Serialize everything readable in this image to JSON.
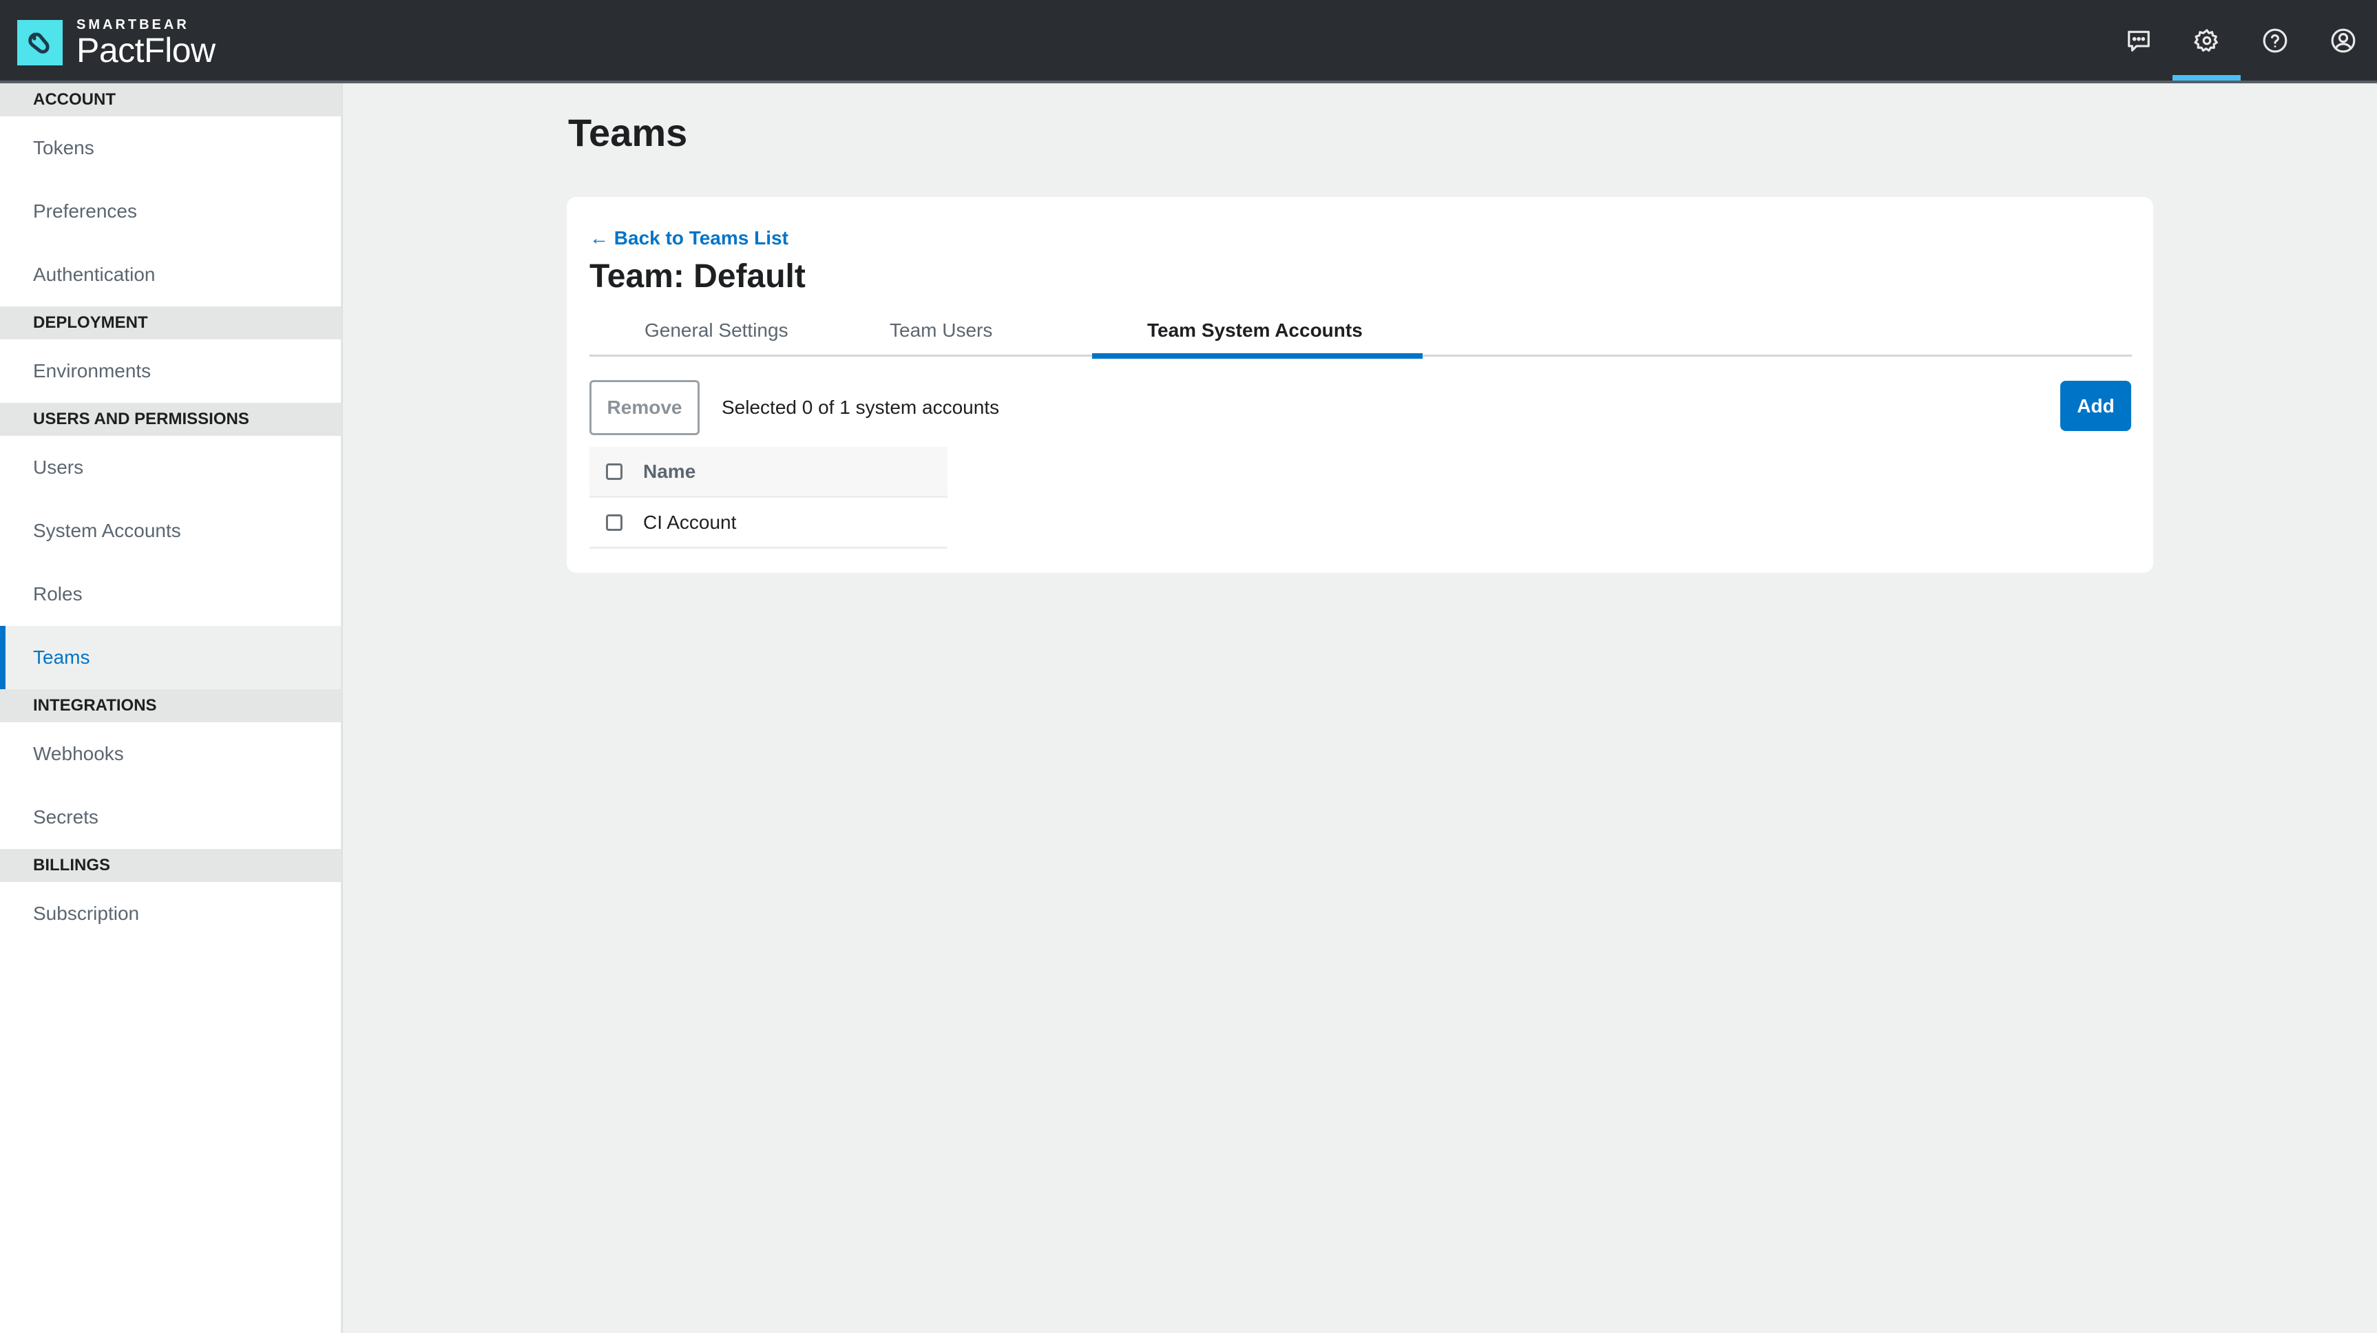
{
  "header": {
    "brand": "SMARTBEAR",
    "product": "PactFlow",
    "nav_icons": [
      {
        "icon": "chat-icon",
        "label": "Feedback",
        "active": false
      },
      {
        "icon": "gear-icon",
        "label": "Settings",
        "active": true
      },
      {
        "icon": "help-icon",
        "label": "Help",
        "active": false
      },
      {
        "icon": "user-icon",
        "label": "Account",
        "active": false
      }
    ],
    "accent": "#4bbff6"
  },
  "sidebar": {
    "sections": [
      {
        "title": "ACCOUNT",
        "items": [
          "Tokens",
          "Preferences",
          "Authentication"
        ]
      },
      {
        "title": "DEPLOYMENT",
        "items": [
          "Environments"
        ]
      },
      {
        "title": "USERS AND PERMISSIONS",
        "items": [
          "Users",
          "System Accounts",
          "Roles",
          "Teams"
        ]
      },
      {
        "title": "INTEGRATIONS",
        "items": [
          "Webhooks",
          "Secrets"
        ]
      },
      {
        "title": "BILLINGS",
        "items": [
          "Subscription"
        ]
      }
    ],
    "active_item": "Teams"
  },
  "main": {
    "page_title": "Teams",
    "back_link": "← Back to Teams List",
    "team_title": "Team: Default",
    "tabs": [
      {
        "label": "General Settings",
        "active": false
      },
      {
        "label": "Team Users",
        "active": false
      },
      {
        "label": "Team System Accounts",
        "active": true
      }
    ],
    "remove_label": "Remove",
    "selection_status": "Selected 0 of 1 system accounts",
    "add_label": "Add",
    "table": {
      "columns": [
        "Name"
      ],
      "rows": [
        {
          "name": "CI Account",
          "checked": false
        }
      ]
    }
  },
  "colors": {
    "primary": "#0074c7",
    "header_bg": "#2a2d31",
    "logo_bg": "#4fe3ec"
  }
}
